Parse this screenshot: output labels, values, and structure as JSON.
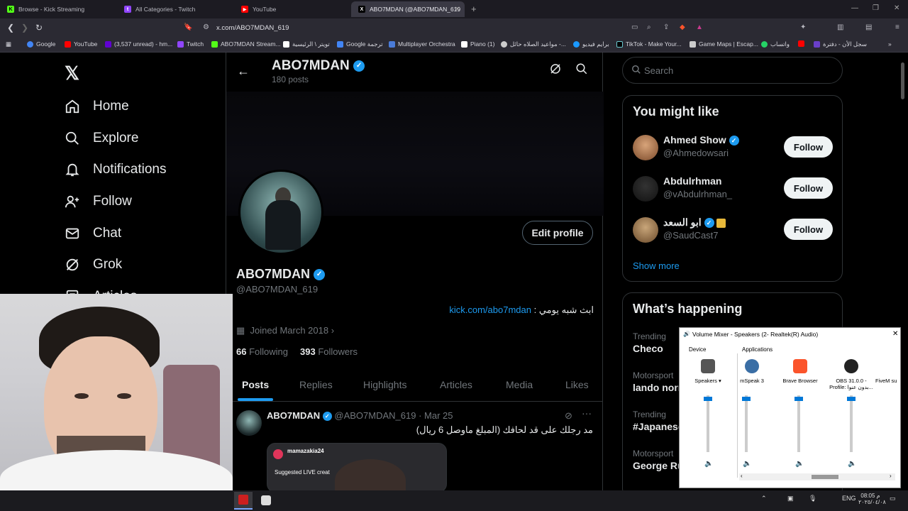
{
  "browser": {
    "tabs": [
      {
        "title": "Browse - Kick Streaming",
        "color": "#53fc18",
        "letter": "K"
      },
      {
        "title": "All Categories - Twitch",
        "color": "#9146ff",
        "letter": "t"
      },
      {
        "title": "YouTube",
        "color": "#ff0000",
        "letter": "▶"
      },
      {
        "title": "ABO7MDAN (@ABO7MDAN_619",
        "color": "#000000",
        "letter": "X"
      }
    ],
    "url": "x.com/ABO7MDAN_619",
    "bookmarks": [
      {
        "label": "Google",
        "color": "#4285f4"
      },
      {
        "label": "YouTube",
        "color": "#ff0000"
      },
      {
        "label": "(3,537 unread) - hm...",
        "color": "#6001d2"
      },
      {
        "label": "Twitch",
        "color": "#9146ff"
      },
      {
        "label": "ABO7MDAN Stream...",
        "color": "#53fc18"
      },
      {
        "label": "تويتر \\ الرئيسية",
        "color": "#ffffff"
      },
      {
        "label": "Google ترجمة",
        "color": "#4285f4"
      },
      {
        "label": "Multiplayer Orchestra",
        "color": "#4a7bd8"
      },
      {
        "label": "Piano (1)",
        "color": "#ffffff"
      },
      {
        "label": "مواعيد الصلاه حائل -...",
        "color": "#cccccc"
      },
      {
        "label": "برايم فيديو",
        "color": "#1a98ff"
      },
      {
        "label": "TikTok - Make Your...",
        "color": "#000000"
      },
      {
        "label": "Game Maps | Escap...",
        "color": "#cccccc"
      },
      {
        "label": "واتساب",
        "color": "#25d366"
      },
      {
        "label": "",
        "color": "#ff0000"
      },
      {
        "label": "سجل الأن - دفترة",
        "color": "#6a3fc9"
      }
    ]
  },
  "nav": {
    "items": [
      {
        "label": "Home",
        "icon": "home-icon"
      },
      {
        "label": "Explore",
        "icon": "search-icon"
      },
      {
        "label": "Notifications",
        "icon": "bell-icon"
      },
      {
        "label": "Follow",
        "icon": "follow-icon"
      },
      {
        "label": "Chat",
        "icon": "mail-icon"
      },
      {
        "label": "Grok",
        "icon": "grok-icon"
      },
      {
        "label": "Articles",
        "icon": "articles-icon"
      }
    ]
  },
  "profile": {
    "name": "ABO7MDAN",
    "posts_count": "180 posts",
    "handle": "@ABO7MDAN_619",
    "edit_label": "Edit profile",
    "bio_text": "ابث شبه يومي :",
    "bio_link": "kick.com/abo7mdan",
    "joined": "Joined March 2018",
    "following_count": "66",
    "following_label": "Following",
    "followers_count": "393",
    "followers_label": "Followers",
    "tabs": [
      "Posts",
      "Replies",
      "Highlights",
      "Articles",
      "Media",
      "Likes"
    ]
  },
  "post": {
    "author": "ABO7MDAN",
    "handle": "@ABO7MDAN_619",
    "date": "· Mar 25",
    "text": "مد رجلك على قد لحافك  (المبلغ ماوصل 6 ريال)",
    "embed_user": "mamazakia24",
    "embed_sub": "Suggested LIVE creat"
  },
  "right": {
    "search_placeholder": "Search",
    "might_like_title": "You might like",
    "suggestions": [
      {
        "name": "Ahmed Show",
        "handle": "@Ahmedowsari",
        "follow": "Follow"
      },
      {
        "name": "Abdulrhman",
        "handle": "@vAbdulrhman_",
        "follow": "Follow"
      },
      {
        "name": "ابو السعد",
        "handle": "@SaudCast7",
        "follow": "Follow"
      }
    ],
    "show_more": "Show more",
    "happening_title": "What’s happening",
    "trends": [
      {
        "cat": "Trending",
        "name": "Checo"
      },
      {
        "cat": "Motorsport",
        "name": "lando norr"
      },
      {
        "cat": "Trending",
        "name": "#Japanese"
      },
      {
        "cat": "Motorsport",
        "name": "George Ru"
      }
    ]
  },
  "mixer": {
    "title": "Volume Mixer - Speakers (2- Realtek(R) Audio)",
    "device_label": "Device",
    "apps_label": "Applications",
    "columns": [
      {
        "name": "Speakers",
        "icon": "speaker-device-icon",
        "level": 0.95
      },
      {
        "name": "mSpeak 3",
        "icon": "mspeak-icon",
        "level": 0.95
      },
      {
        "name": "Brave Browser",
        "icon": "brave-icon",
        "level": 0.95
      },
      {
        "name": "OBS 31.0.0 - Profile: بدون عنوا...",
        "icon": "obs-icon",
        "level": 0.95
      },
      {
        "name": "FiveM su",
        "icon": "fivem-icon",
        "level": 0.95
      }
    ]
  },
  "taskbar": {
    "lang": "ENG",
    "time": "08:05 م",
    "date": "٢٠٢٥/٠٤/٠٨"
  }
}
